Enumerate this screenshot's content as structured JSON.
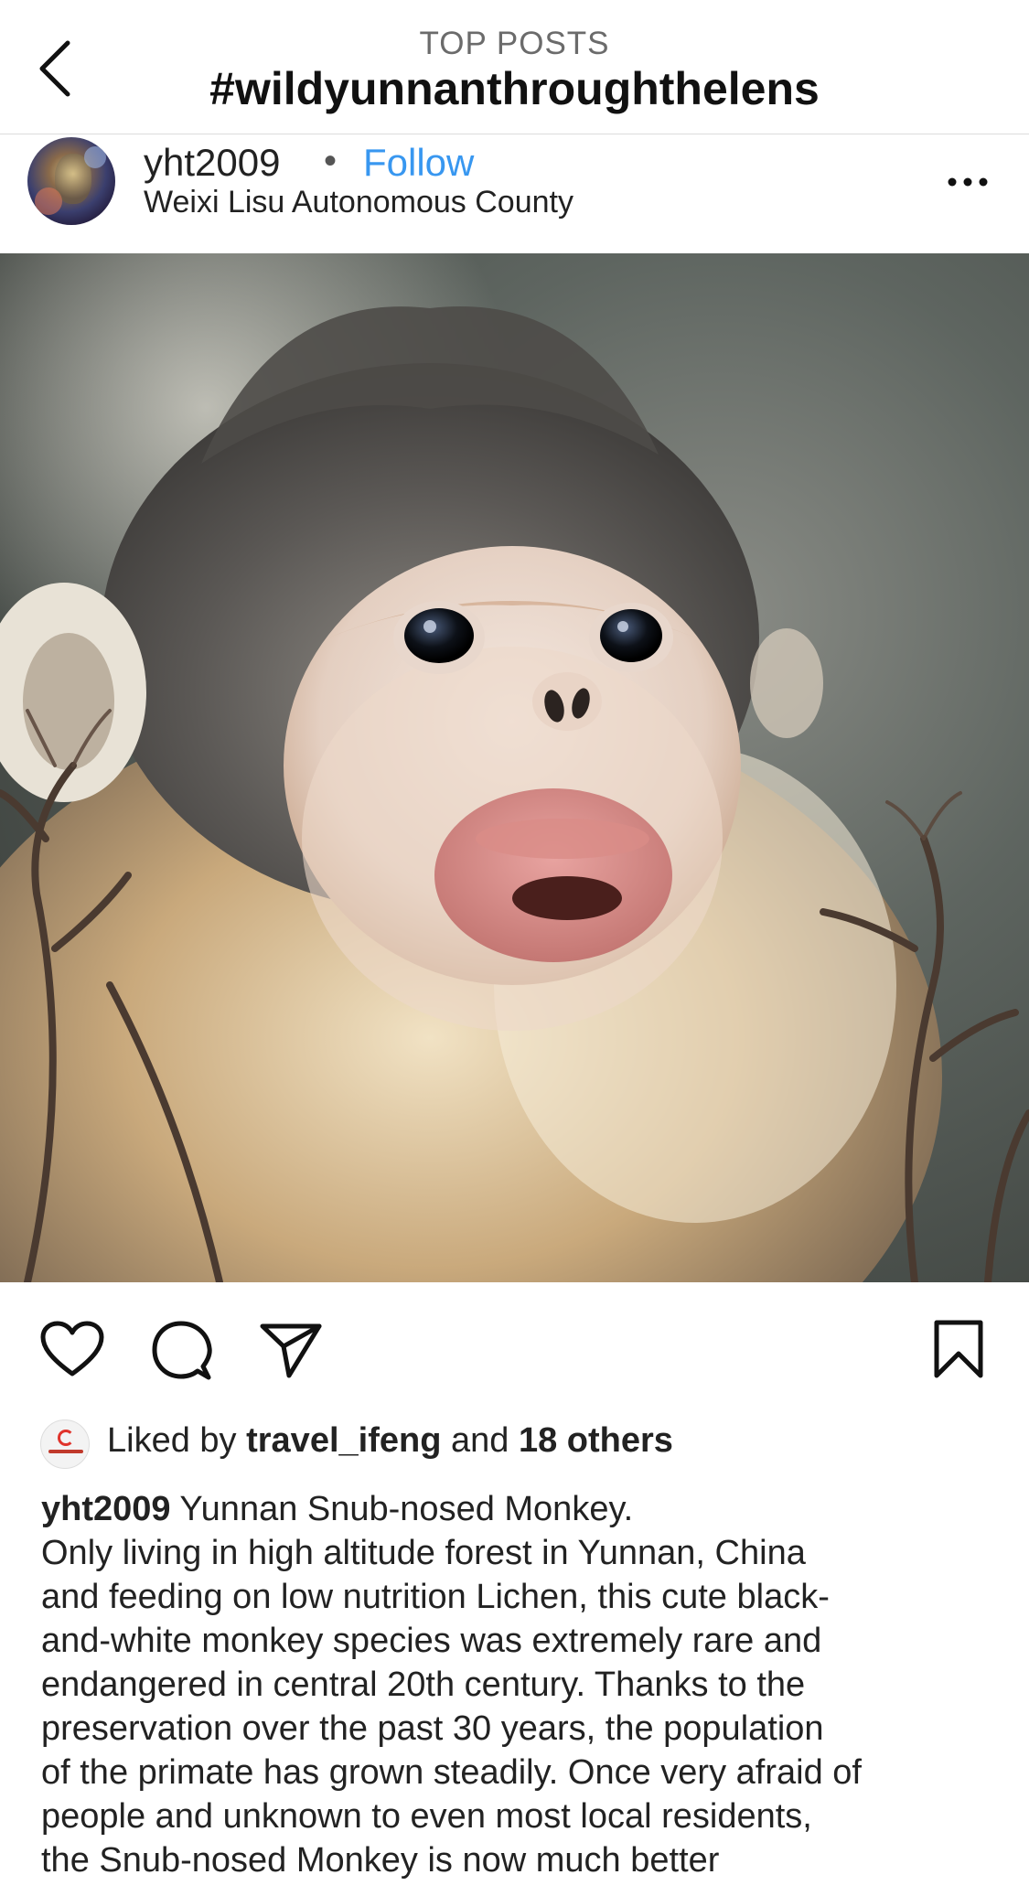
{
  "header": {
    "eyebrow": "TOP POSTS",
    "title": "#wildyunnanthroughthelens"
  },
  "post": {
    "username": "yht2009",
    "separator": "•",
    "follow_label": "Follow",
    "location": "Weixi Lisu Autonomous County",
    "image_subject": "Yunnan snub-nosed monkey photo",
    "likes": {
      "prefix": "Liked by",
      "liker": "travel_ifeng",
      "middle": "and",
      "others": "18 others"
    },
    "caption": {
      "username": "yht2009",
      "first_line": "Yunnan Snub-nosed Monkey.",
      "lines": [
        "Only living in high altitude forest in Yunnan, China",
        "and feeding on low nutrition Lichen, this cute black-",
        "and-white monkey species was extremely rare and",
        "endangered in central 20th century. Thanks to the",
        "preservation over the past 30 years, the population",
        "of the primate has grown steadily. Once very afraid of",
        "people and unknown to even most local residents,",
        "the Snub-nosed Monkey is now much better"
      ]
    }
  },
  "icons": {
    "back": "chevron-left-icon",
    "more": "more-horizontal-icon",
    "like": "heart-icon",
    "comment": "comment-bubble-icon",
    "share": "paper-plane-icon",
    "save": "bookmark-icon"
  },
  "colors": {
    "link_blue": "#3897f0",
    "text": "#222222",
    "muted": "#6b6b6b"
  }
}
